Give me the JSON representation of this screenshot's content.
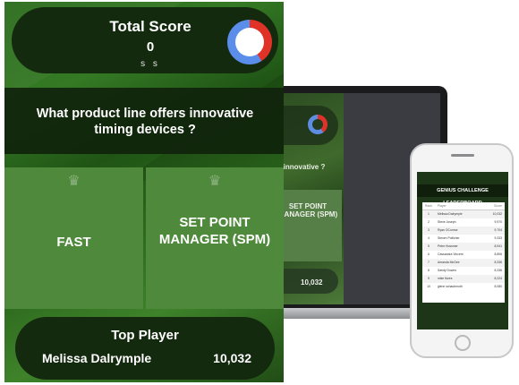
{
  "main": {
    "score_label": "Total Score",
    "score_value": "0",
    "score_units": "s s",
    "question": "What product line offers innovative timing devices ?",
    "answers": [
      {
        "label": "FAST"
      },
      {
        "label": "SET POINT MANAGER (SPM)"
      }
    ],
    "top_player_label": "Top Player",
    "top_player_name": "Melissa Dalrymple",
    "top_player_score": "10,032"
  },
  "laptop": {
    "question_fragment": "s innovative ?",
    "answer_fragment": "SET POINT MANAGER (SPM)",
    "score": "10,032"
  },
  "phone": {
    "title": "GENIUS CHALLENGE LEADERBOARD",
    "columns": [
      "Rank",
      "Player",
      "Score"
    ],
    "rows": [
      {
        "rank": "1",
        "player": "Melissa Dalrymple",
        "score": "10,032"
      },
      {
        "rank": "2",
        "player": "Steve Joseph",
        "score": "9,970"
      },
      {
        "rank": "3",
        "player": "Ryan OConnor",
        "score": "9,704"
      },
      {
        "rank": "4",
        "player": "Steven Pollicher",
        "score": "9,333"
      },
      {
        "rank": "5",
        "player": "Peter Hussmer",
        "score": "8,941"
      },
      {
        "rank": "6",
        "player": "Cassandra Vincent",
        "score": "8,806"
      },
      {
        "rank": "7",
        "player": "Amanda McGee",
        "score": "8,336"
      },
      {
        "rank": "8",
        "player": "Sandy Downs",
        "score": "8,336"
      },
      {
        "rank": "9",
        "player": "mike flores",
        "score": "8,224"
      },
      {
        "rank": "10",
        "player": "glenn schaubmuth",
        "score": "8,080"
      }
    ]
  },
  "colors": {
    "timer_elapsed": "#e13227",
    "timer_remaining": "#5b8eea",
    "answer_tile": "#4f8a3c",
    "pill_dark": "#142a0f"
  },
  "timer_fraction_elapsed": 0.41
}
